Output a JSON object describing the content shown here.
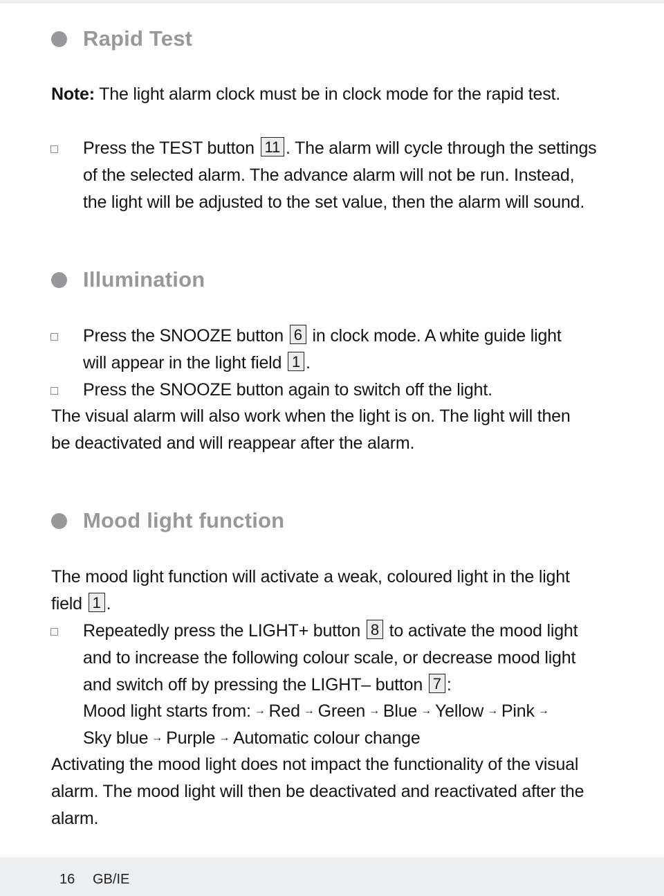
{
  "sections": {
    "rapid_test": {
      "title": "Rapid Test",
      "note_label": "Note:",
      "note_text": " The light alarm clock must be in clock mode for the rapid test.",
      "step1": {
        "l1_a": "Press the TEST button",
        "ref_test": "11",
        "l1_b": ". The alarm will cycle through the settings",
        "l2": "of the selected alarm. The advance alarm will not be run. Instead,",
        "l3": "the light will be adjusted to the set value, then the alarm will sound."
      }
    },
    "illumination": {
      "title": "Illumination",
      "step1": {
        "l1_a": "Press the SNOOZE button",
        "ref_snooze": "6",
        "l1_b": "in clock mode. A white guide light",
        "l2_a": "will appear in the light field",
        "ref_light_field": "1",
        "l2_b": "."
      },
      "step2": "Press the SNOOZE button again to switch off the light.",
      "para_l1": "The visual alarm will also work when the light is on. The light will then",
      "para_l2": "be deactivated and will reappear after the alarm."
    },
    "mood_light": {
      "title": "Mood light function",
      "intro_l1": "The mood light function will activate a weak, coloured light in the light",
      "intro_l2_a": "field",
      "ref_light_field": "1",
      "intro_l2_b": ".",
      "step1": {
        "l1_a": "Repeatedly press the LIGHT+ button",
        "ref_light_plus": "8",
        "l1_b": "to activate the mood light",
        "l2": "and to increase the following colour scale, or decrease mood light",
        "l3_a": "and switch off by pressing the LIGHT– button",
        "ref_light_minus": "7",
        "l3_b": ":",
        "sequence_label": "Mood light starts from:",
        "arrow": "→",
        "colours": [
          "Red",
          "Green",
          "Blue",
          "Yellow",
          "Pink",
          "Sky blue",
          "Purple",
          "Automatic colour change"
        ]
      },
      "outro_l1": "Activating the mood light does not impact the functionality of the visual",
      "outro_l2": "alarm. The mood light will then be deactivated and reactivated after the",
      "outro_l3": "alarm."
    }
  },
  "footer": {
    "page_number": "16",
    "locale": "GB/IE"
  }
}
